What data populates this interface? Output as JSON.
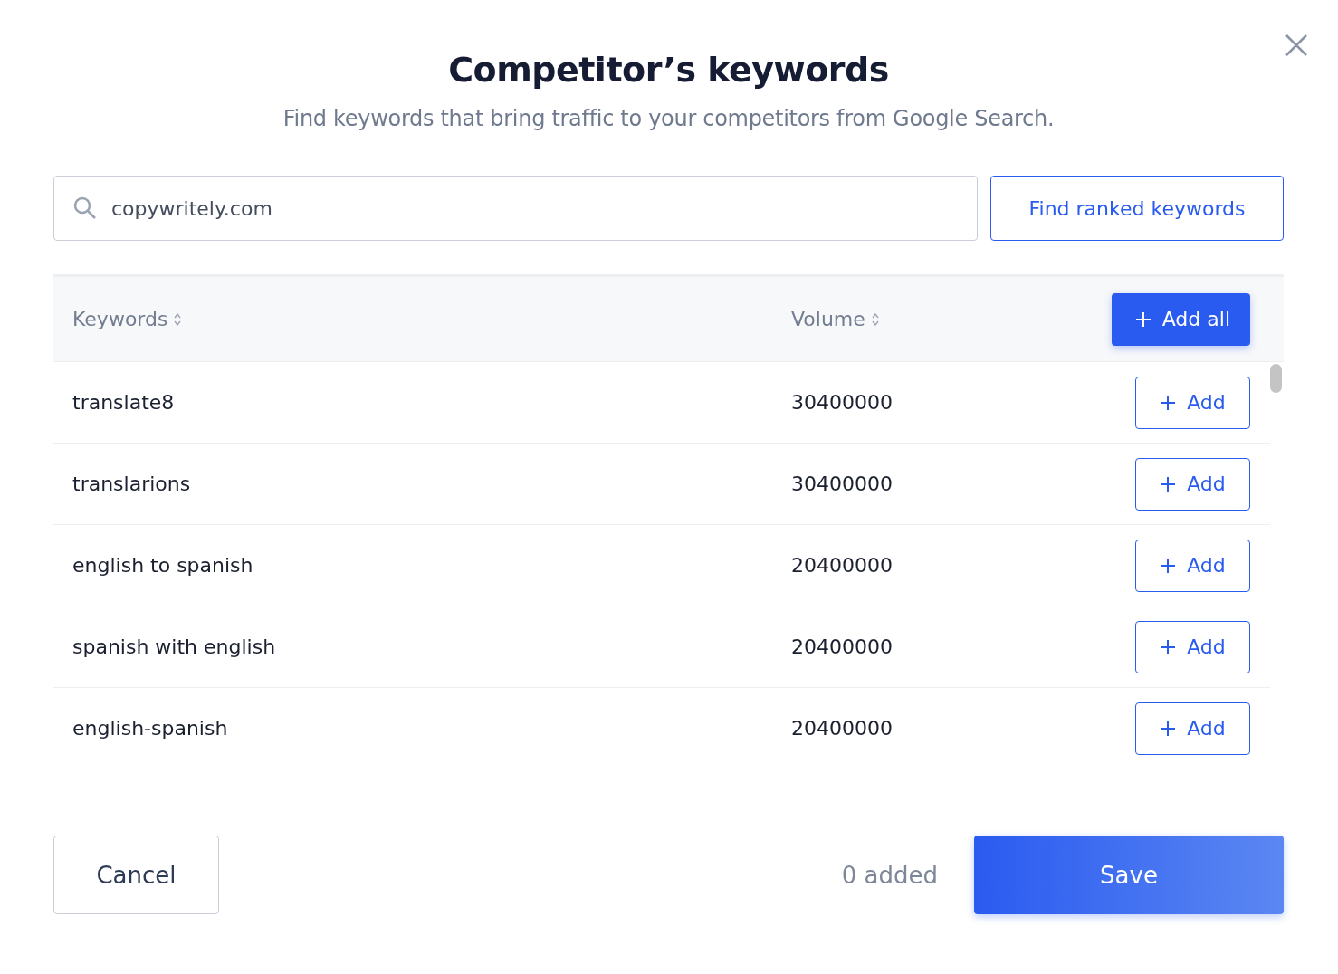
{
  "dialog": {
    "title": "Competitor’s keywords",
    "subtitle": "Find keywords that bring traffic to your competitors from Google Search."
  },
  "search": {
    "value": "copywritely.com",
    "button": "Find ranked keywords"
  },
  "table": {
    "columns": [
      "Keywords",
      "Volume"
    ],
    "add_all": "Add all",
    "rows": [
      {
        "keyword": "translate8",
        "volume": "30400000",
        "action": "Add"
      },
      {
        "keyword": "translarions",
        "volume": "30400000",
        "action": "Add"
      },
      {
        "keyword": "english to spanish",
        "volume": "20400000",
        "action": "Add"
      },
      {
        "keyword": "spanish with english",
        "volume": "20400000",
        "action": "Add"
      },
      {
        "keyword": "english-spanish",
        "volume": "20400000",
        "action": "Add"
      }
    ]
  },
  "footer": {
    "cancel": "Cancel",
    "count": "0 added",
    "save": "Save"
  }
}
